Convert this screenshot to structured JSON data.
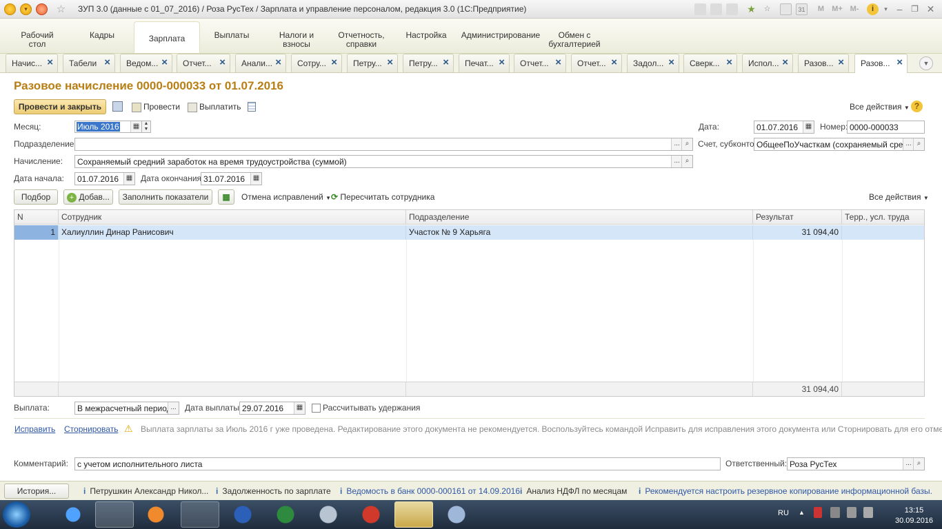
{
  "window": {
    "title": "ЗУП 3.0 (данные с 01_07_2016) / Роза РусТех / Зарплата и управление персоналом, редакция 3.0  (1С:Предприятие)",
    "sys_letters": [
      "M",
      "M+",
      "M-"
    ]
  },
  "sections": [
    {
      "label": "Рабочий стол"
    },
    {
      "label": "Кадры"
    },
    {
      "label": "Зарплата"
    },
    {
      "label": "Выплаты"
    },
    {
      "label": "Налоги и взносы"
    },
    {
      "label": "Отчетность, справки"
    },
    {
      "label": "Настройка"
    },
    {
      "label": "Администрирование"
    },
    {
      "label": "Обмен с бухгалтерией"
    }
  ],
  "open_tabs": [
    {
      "label": "Начис..."
    },
    {
      "label": "Табели"
    },
    {
      "label": "Ведом..."
    },
    {
      "label": "Отчет..."
    },
    {
      "label": "Анали..."
    },
    {
      "label": "Сотру..."
    },
    {
      "label": "Петру..."
    },
    {
      "label": "Петру..."
    },
    {
      "label": "Печат..."
    },
    {
      "label": "Отчет..."
    },
    {
      "label": "Отчет..."
    },
    {
      "label": "Задол..."
    },
    {
      "label": "Сверк..."
    },
    {
      "label": "Испол..."
    },
    {
      "label": "Разов..."
    },
    {
      "label": "Разов..."
    }
  ],
  "doc": {
    "title": "Разовое начисление 0000-000033 от 01.07.2016",
    "toolbar": {
      "post_close": "Провести и закрыть",
      "post": "Провести",
      "pay": "Выплатить",
      "all_actions": "Все действия"
    },
    "fields": {
      "month_label": "Месяц:",
      "month_value": "Июль 2016",
      "date_label": "Дата:",
      "date_value": "01.07.2016",
      "number_label": "Номер:",
      "number_value": "0000-000033",
      "division_label": "Подразделение:",
      "division_value": "",
      "account_label": "Счет, субконто:",
      "account_value": "ОбщееПоУчасткам (сохраняемый сред за",
      "accrual_label": "Начисление:",
      "accrual_value": "Сохраняемый средний заработок на время трудоустройства (суммой)",
      "start_label": "Дата начала:",
      "start_value": "01.07.2016",
      "end_label": "Дата окончания:",
      "end_value": "31.07.2016"
    },
    "table_toolbar": {
      "pick": "Подбор",
      "add": "Добав...",
      "fill": "Заполнить показатели",
      "cancel_fix": "Отмена исправлений",
      "recalc": "Пересчитать сотрудника",
      "all_actions": "Все действия"
    },
    "table": {
      "columns": [
        "N",
        "Сотрудник",
        "Подразделение",
        "Результат",
        "Терр., усл. труда"
      ],
      "rows": [
        {
          "n": "1",
          "employee": "Халиуллин Динар Ранисович",
          "division": "Участок № 9 Харьяга",
          "result": "31 094,40",
          "terr": ""
        }
      ],
      "total": "31 094,40"
    },
    "payment": {
      "label": "Выплата:",
      "value": "В межрасчетный период",
      "date_label": "Дата выплаты:",
      "date_value": "29.07.2016",
      "deductions_label": "Рассчитывать удержания",
      "deductions_checked": false
    },
    "links": {
      "fix": "Исправить",
      "reverse": "Сторнировать",
      "warning": "Выплата зарплаты за Июль 2016 г уже проведена. Редактирование этого документа не рекомендуется. Воспользуйтесь командой Исправить для исправления этого документа или Сторнировать для его отмены"
    },
    "comment": {
      "label": "Комментарий:",
      "value": "с учетом исполнительного листа",
      "responsible_label": "Ответственный:",
      "responsible_value": "Роза РусТех"
    }
  },
  "statusbar": {
    "history": "История...",
    "items": [
      "Петрушкин Александр Никол...",
      "Задолженность по зарплате",
      "Ведомость в банк 0000-000161 от 14.09.2016",
      "Анализ НДФЛ по месяцам",
      "Рекомендуется настроить резервное копирование информационной базы."
    ]
  },
  "taskbar": {
    "lang": "RU",
    "time": "13:15",
    "date": "30.09.2016"
  },
  "colors": {
    "title_accent": "#b97e13",
    "link": "#2f57a5",
    "selected_row": "#d4e6f8"
  }
}
